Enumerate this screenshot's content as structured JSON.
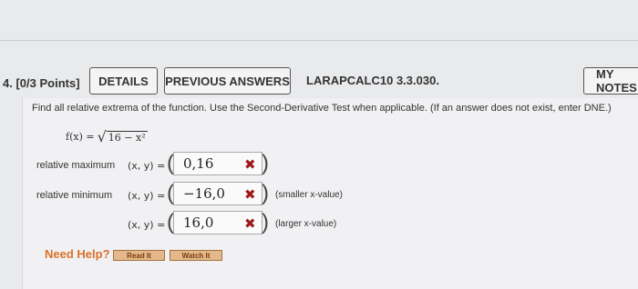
{
  "question": {
    "number": "4.",
    "points": "[0/3 Points]",
    "details_label": "DETAILS",
    "previous_answers_label": "PREVIOUS ANSWERS",
    "code": "LARAPCALC10 3.3.030.",
    "my_notes_label": "MY NOTES"
  },
  "instructions": "Find all relative extrema of the function. Use the Second-Derivative Test when applicable. (If an answer does not exist, enter DNE.)",
  "function": {
    "lhs": "f(x) =",
    "radicand": "16 − x²"
  },
  "answers": [
    {
      "label": "relative maximum",
      "prefix": "(x, y) =",
      "value": "0,16",
      "status": "incorrect",
      "note": ""
    },
    {
      "label": "relative minimum",
      "prefix": "(x, y) =",
      "value": "−16,0",
      "status": "incorrect",
      "note": "(smaller x-value)"
    },
    {
      "label": "",
      "prefix": "(x, y) =",
      "value": "16,0",
      "status": "incorrect",
      "note": "(larger x-value)"
    }
  ],
  "help": {
    "label": "Need Help?",
    "read_label": "Read It",
    "watch_label": "Watch It"
  },
  "colors": {
    "incorrect_mark": "#9b1b1b",
    "help_text": "#d9722a",
    "help_button": "#e4b88a"
  }
}
